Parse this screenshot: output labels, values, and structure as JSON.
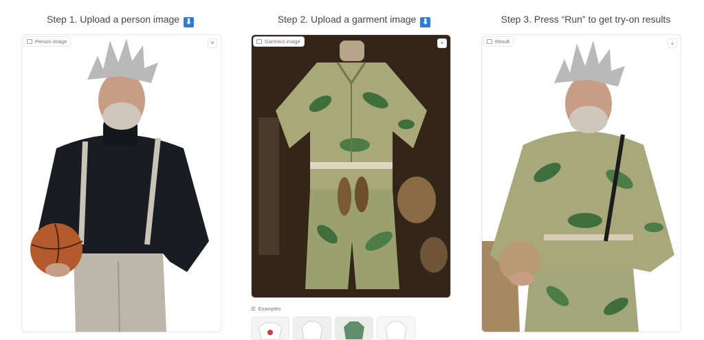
{
  "steps": {
    "step1": "Step 1. Upload a person image",
    "step2": "Step 2. Upload a garment image",
    "step3": "Step 3. Press “Run” to get try-on results"
  },
  "panels": {
    "person_label": "Person image",
    "garment_label": "Garment image",
    "result_label": "Result"
  },
  "icons": {
    "arrow": "arrow-down-icon",
    "close": "close-icon",
    "download": "download-icon",
    "image": "image-icon",
    "list": "list-icon"
  },
  "glyphs": {
    "arrow": "⬇",
    "close": "×",
    "download": "⤓",
    "list": "☰"
  },
  "examples": {
    "label": "Examples"
  },
  "colors": {
    "arrow_badge": "#2f7bd8",
    "border": "#e5e7eb"
  }
}
